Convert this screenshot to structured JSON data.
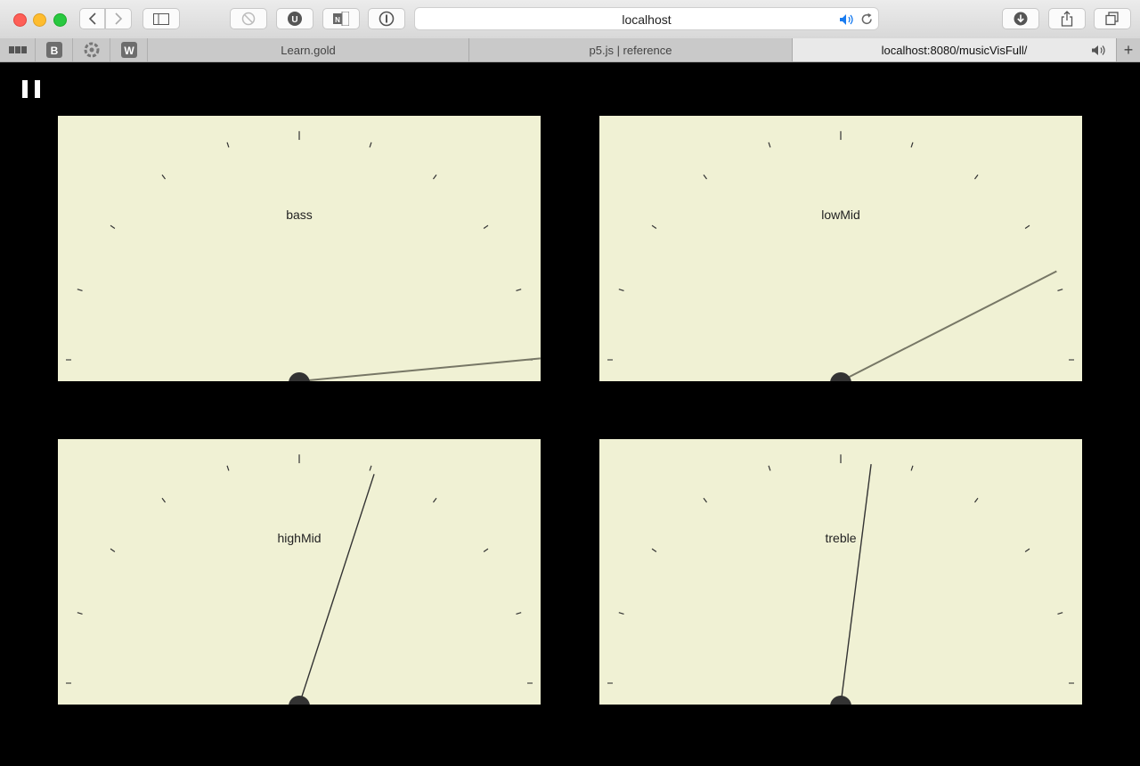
{
  "browser": {
    "url": "localhost",
    "icons": [
      "back-arrow-icon",
      "forward-arrow-icon",
      "sidebar-icon",
      "block-icon",
      "ublock-icon",
      "onenote-icon",
      "password-icon",
      "speaker-icon",
      "reload-icon",
      "download-icon",
      "share-icon",
      "tabs-icon"
    ],
    "favorites": [
      "bbc-icon",
      "bold-b-icon",
      "extension-icon",
      "wikipedia-w-icon"
    ],
    "tabs": [
      {
        "label": "Learn.gold",
        "active": false
      },
      {
        "label": "p5.js | reference",
        "active": false
      },
      {
        "label": "localhost:8080/musicVisFull/",
        "active": true
      }
    ],
    "new_tab_label": "+"
  },
  "meters": [
    {
      "label": "bass",
      "level": 0.97
    },
    {
      "label": "lowMid",
      "level": 0.85
    },
    {
      "label": "highMid",
      "level": 0.6
    },
    {
      "label": "treble",
      "level": 0.54
    }
  ],
  "colors": {
    "meter_face": "#f0f1d4",
    "needle": "#444444",
    "pivot": "#333333",
    "background": "#000000"
  }
}
